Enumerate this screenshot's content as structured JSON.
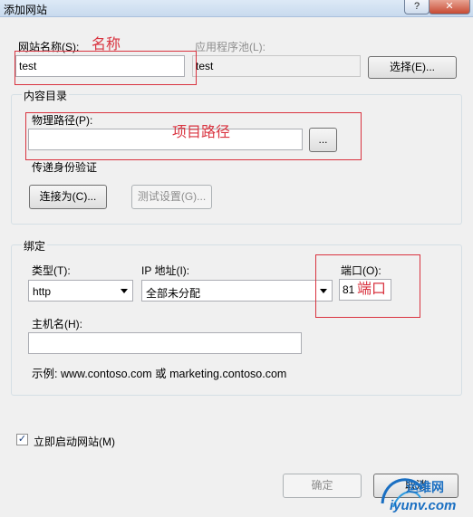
{
  "window": {
    "title": "添加网站",
    "help_glyph": "?",
    "close_glyph": "✕"
  },
  "site_name": {
    "label": "网站名称(S):",
    "value": "test"
  },
  "app_pool": {
    "label": "应用程序池(L):",
    "value": "test",
    "select_button": "选择(E)..."
  },
  "content_dir": {
    "group_title": "内容目录",
    "physical_path_label": "物理路径(P):",
    "physical_path_value": "",
    "browse_button": "...",
    "pass_auth_label": "传递身份验证",
    "connect_as_button": "连接为(C)...",
    "test_settings_button": "测试设置(G)..."
  },
  "binding": {
    "group_title": "绑定",
    "type_label": "类型(T):",
    "type_value": "http",
    "ip_label": "IP 地址(I):",
    "ip_value": "全部未分配",
    "port_label": "端口(O):",
    "port_value": "81",
    "host_label": "主机名(H):",
    "host_value": "",
    "example": "示例: www.contoso.com 或 marketing.contoso.com"
  },
  "start_now": {
    "label": "立即启动网站(M)",
    "checked": true
  },
  "footer": {
    "ok_button": "确定",
    "cancel_button": "取消"
  },
  "annotations": {
    "name_note": "名称",
    "path_note": "项目路径",
    "port_note": "端口"
  },
  "watermark": {
    "text1": "运维网",
    "text2": "iyunv.com"
  },
  "colors": {
    "annotation": "#d9333f",
    "watermark_blue": "#1a6fc2"
  }
}
